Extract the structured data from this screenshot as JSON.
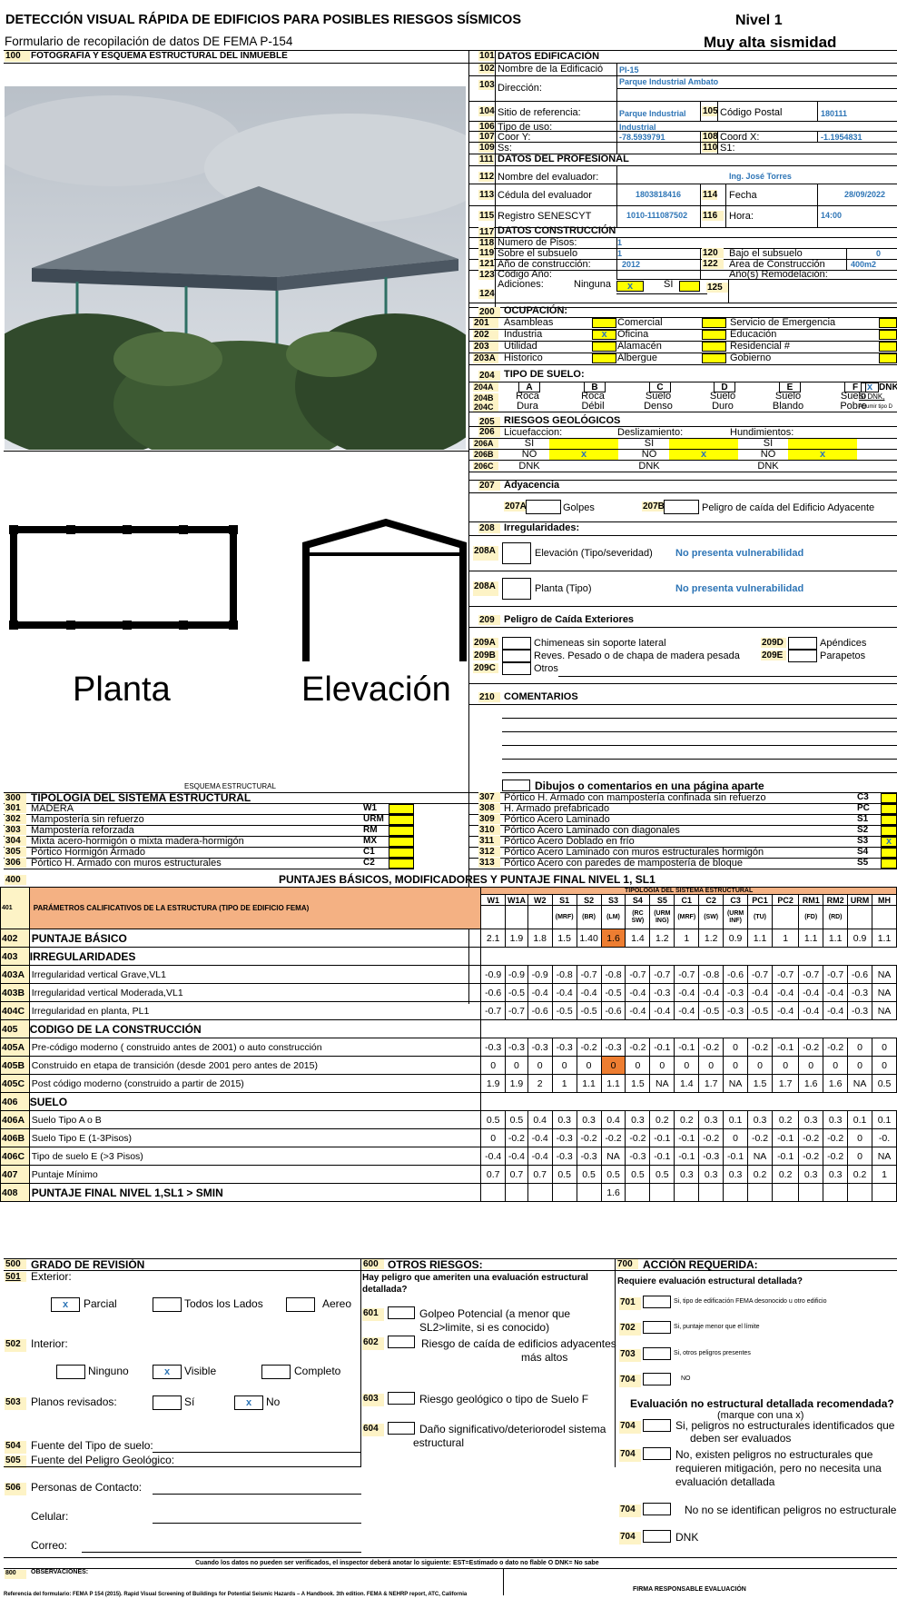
{
  "header": {
    "title": "DETECCIÓN VISUAL RÁPIDA DE EDIFICIOS PARA POSIBLES RIESGOS SÍSMICOS",
    "subtitle": "Formulario de recopilación de datos DE FEMA P-154",
    "level": "Nivel 1",
    "seismicity": "Muy alta sismidad"
  },
  "photo_section": {
    "num": "100",
    "label": "FOTOGRAFÍA Y ESQUEMA ESTRUCTURAL DEL INMUEBLE",
    "plan_label": "Planta",
    "elev_label": "Elevación",
    "schema_label": "ESQUEMA ESTRUCTURAL"
  },
  "building": {
    "r101": {
      "n": "101",
      "l": "DATOS EDIFICACIÓN"
    },
    "r102": {
      "n": "102",
      "l": "Nombre de la Edificació",
      "v": "PI-15"
    },
    "r103": {
      "n": "103",
      "l": "Dirección:",
      "v": "Parque Industrial Ambato"
    },
    "r104": {
      "n": "104",
      "l": "Sitio de referencia:",
      "v": "Parque Industrial"
    },
    "r105": {
      "n": "105",
      "l": "Código Postal",
      "v": "180111"
    },
    "r106": {
      "n": "106",
      "l": "Tipo de uso:",
      "v": "Industrial"
    },
    "r107": {
      "n": "107",
      "l": "Coor Y:",
      "v": "-78.5939791"
    },
    "r108": {
      "n": "108",
      "l": "Coord X:",
      "v": "-1.1954831"
    },
    "r109": {
      "n": "109",
      "l": "Ss:"
    },
    "r110": {
      "n": "110",
      "l": "S1:"
    }
  },
  "professional": {
    "r111": {
      "n": "111",
      "l": "DATOS DEL PROFESIONAL"
    },
    "r112": {
      "n": "112",
      "l": "Nombre del evaluador:",
      "v": "Ing. José Torres"
    },
    "r113": {
      "n": "113",
      "l": "Cédula del evaluador",
      "v": "1803818416"
    },
    "r114": {
      "n": "114",
      "l": "Fecha",
      "v": "28/09/2022"
    },
    "r115": {
      "n": "115",
      "l": "Registro SENESCYT",
      "v": "1010-111087502"
    },
    "r116": {
      "n": "116",
      "l": "Hora:",
      "v": "14:00"
    }
  },
  "construction": {
    "r117": {
      "n": "117",
      "l": "DATOS CONSTRUCCIÓN"
    },
    "r118": {
      "n": "118",
      "l": "Numero de Pisos:",
      "v": "1"
    },
    "r119": {
      "n": "119",
      "l": "Sobre el subsuelo",
      "v": "1"
    },
    "r120": {
      "n": "120",
      "l": "Bajo el subsuelo",
      "v": "0"
    },
    "r121": {
      "n": "121",
      "l": "Año de construcción:",
      "v": "2012"
    },
    "r122": {
      "n": "122",
      "l": "Area de Construcción",
      "v": "400m2"
    },
    "r123": {
      "n": "123",
      "l": "Código Año:"
    },
    "r123b": {
      "l": "Año(s) Remodelación:"
    },
    "r124": {
      "n": "124",
      "l": "Adiciones:",
      "none": "Ninguna",
      "si": "SI",
      "mark": "x"
    },
    "r125": {
      "n": "125"
    }
  },
  "occupancy": {
    "n": "200",
    "title": "OCUPACIÓN:",
    "rows": [
      {
        "n": "201",
        "a": "Asambleas",
        "b": "Comercial",
        "c": "Servicio de  Emergencia"
      },
      {
        "n": "202",
        "a": "Industria",
        "am": "x",
        "b": "Oficina",
        "c": "Educación"
      },
      {
        "n": "203",
        "a": "Utilidad",
        "b": "Alamacén",
        "c": "Residencial #"
      },
      {
        "n": "203A",
        "a": "Historico",
        "b": "Albergue",
        "c": "Gobierno"
      }
    ]
  },
  "soil": {
    "n": "204",
    "title": "TIPO DE SUELO:",
    "n_a": "204A",
    "n_b": "204B",
    "n_c": "204C",
    "letters": [
      "A",
      "B",
      "C",
      "D",
      "E",
      "F"
    ],
    "dnk_mark": "x",
    "dnk": "DNK",
    "row_b": [
      "Roca",
      "Roca",
      "Suelo",
      "Suelo",
      "Suelo",
      "Suelo"
    ],
    "row_c": [
      "Dura",
      "Débil",
      "Denso",
      "Duro",
      "Blando",
      "Pobre"
    ],
    "dnk_b": "Si DNK,",
    "dnk_c": "ASumir tipo D"
  },
  "geo": {
    "n": "205",
    "title": "RIESGOS GEOLÓGICOS",
    "n206": "206",
    "liq": "Licuefaccion:",
    "des": "Deslizamiento:",
    "hun": "Hundimientos:",
    "n206a": "206A",
    "n206b": "206B",
    "n206c": "206C",
    "si": "SI",
    "no": "NO",
    "dnk": "DNK",
    "mark": "x"
  },
  "adjacency": {
    "n": "207",
    "title": "Adyacencia",
    "n207a": "207A",
    "golpes": "Golpes",
    "n207b": "207B",
    "peligro": "Peligro de caída del Edificio Adyacente"
  },
  "irregular": {
    "n": "208",
    "title": "Irregularidades:",
    "n208a": "208A",
    "elev": "Elevación (Tipo/severidad)",
    "elev_v": "No presenta vulnerabilidad",
    "plan": "Planta (Tipo)",
    "plan_v": "No presenta vulnerabilidad"
  },
  "exterior": {
    "n": "209",
    "title": "Peligro de Caída Exteriores",
    "n209a": "209A",
    "n209b": "209B",
    "n209c": "209C",
    "n209d": "209D",
    "n209e": "209E",
    "a": "Chimeneas sin soporte lateral",
    "b": "Reves. Pesado o de chapa de madera pesada",
    "c": "Otros",
    "d": "Apéndices",
    "e": "Parapetos"
  },
  "comments": {
    "n": "210",
    "title": "COMENTARIOS",
    "note": "Dibujos o comentarios en una página aparte"
  },
  "typology": {
    "n": "300",
    "title": "TIPOLOGIA DEL SISTEMA ESTRUCTURAL",
    "left": [
      {
        "n": "301",
        "l": "MADERA",
        "c": "W1"
      },
      {
        "n": "302",
        "l": "Mampostería sin refuerzo",
        "c": "URM"
      },
      {
        "n": "303",
        "l": "Mampostería reforzada",
        "c": "RM"
      },
      {
        "n": "304",
        "l": "Mixta acero-hormigón o mixta madera-hormigón",
        "c": "MX"
      },
      {
        "n": "305",
        "l": "Pórtico Hormigón Armado",
        "c": "C1"
      },
      {
        "n": "306",
        "l": "Pórtico H. Armado con muros estructurales",
        "c": "C2"
      }
    ],
    "right": [
      {
        "n": "307",
        "l": "Pórtico H. Armado con mampostería confinada sin refuerzo",
        "c": "C3"
      },
      {
        "n": "308",
        "l": "H. Armado prefabricado",
        "c": "PC"
      },
      {
        "n": "309",
        "l": "Pórtico Acero Laminado",
        "c": "S1"
      },
      {
        "n": "310",
        "l": "Pórtico Acero Laminado con diagonales",
        "c": "S2"
      },
      {
        "n": "311",
        "l": "Pórtico Acero Doblado en frío",
        "c": "S3",
        "m": "x"
      },
      {
        "n": "312",
        "l": "Pórtico Acero Laminado con muros estructurales hormigón",
        "c": "S4"
      },
      {
        "n": "313",
        "l": "Pórtico Acero con paredes de mampostería de bloque",
        "c": "S5"
      }
    ]
  },
  "scores": {
    "n400": "400",
    "title": "PUNTAJES BÁSICOS, MODIFICADORES Y PUNTAJE FINAL NIVEL 1,  SL1",
    "n401": "401",
    "param": "PARÁMETROS CALIFICATIVOS DE LA ESTRUCTURA (TIPO DE EDIFICIO FEMA)",
    "typ_header": "TIPOLOGIA DEL SISTEMA ESTRUCTURAL",
    "cols": [
      "W1",
      "W1A",
      "W2",
      "S1",
      "S2",
      "S3",
      "S4",
      "S5",
      "C1",
      "C2",
      "C3",
      "PC1",
      "PC2",
      "RM1",
      "RM2",
      "URM",
      "MH"
    ],
    "subs": [
      "",
      "",
      "",
      "(MRF)",
      "(BR)",
      "(LM)",
      "(RC SW)",
      "(URM ING)",
      "(MRF)",
      "(SW)",
      "(URM INF)",
      "(TU)",
      "",
      "(FD)",
      "(RD)",
      "",
      ""
    ],
    "rows": [
      {
        "n": "402",
        "l": "PUNTAJE BÁSICO",
        "b": true,
        "v": [
          "2.1",
          "1.9",
          "1.8",
          "1.5",
          "1.40",
          "1.6",
          "1.4",
          "1.2",
          "1",
          "1.2",
          "0.9",
          "1.1",
          "1",
          "1.1",
          "1.1",
          "0.9",
          "1.1"
        ]
      },
      {
        "n": "403",
        "l": "IRREGULARIDADES",
        "sec": true
      },
      {
        "n": "403A",
        "l": "Irregularidad vertical Grave,VL1",
        "v": [
          "-0.9",
          "-0.9",
          "-0.9",
          "-0.8",
          "-0.7",
          "-0.8",
          "-0.7",
          "-0.7",
          "-0.7",
          "-0.8",
          "-0.6",
          "-0.7",
          "-0.7",
          "-0.7",
          "-0.7",
          "-0.6",
          "NA"
        ]
      },
      {
        "n": "403B",
        "l": "Irregularidad vertical Moderada,VL1",
        "v": [
          "-0.6",
          "-0.5",
          "-0.4",
          "-0.4",
          "-0.4",
          "-0.5",
          "-0.4",
          "-0.3",
          "-0.4",
          "-0.4",
          "-0.3",
          "-0.4",
          "-0.4",
          "-0.4",
          "-0.4",
          "-0.3",
          "NA"
        ]
      },
      {
        "n": "404C",
        "l": "Irregularidad en planta, PL1",
        "v": [
          "-0.7",
          "-0.7",
          "-0.6",
          "-0.5",
          "-0.5",
          "-0.6",
          "-0.4",
          "-0.4",
          "-0.4",
          "-0.5",
          "-0.3",
          "-0.5",
          "-0.4",
          "-0.4",
          "-0.4",
          "-0.3",
          "NA"
        ]
      },
      {
        "n": "405",
        "l": "CODIGO DE LA CONSTRUCCIÓN",
        "sec": true
      },
      {
        "n": "405A",
        "l": "Pre-código moderno ( construido antes de 2001) o auto construcción",
        "v": [
          "-0.3",
          "-0.3",
          "-0.3",
          "-0.3",
          "-0.2",
          "-0.3",
          "-0.2",
          "-0.1",
          "-0.1",
          "-0.2",
          "0",
          "-0.2",
          "-0.1",
          "-0.2",
          "-0.2",
          "0",
          "0"
        ]
      },
      {
        "n": "405B",
        "l": "Construido en etapa de transición (desde 2001 pero antes de 2015)",
        "v": [
          "0",
          "0",
          "0",
          "0",
          "0",
          "0",
          "0",
          "0",
          "0",
          "0",
          "0",
          "0",
          "0",
          "0",
          "0",
          "0",
          "0"
        ],
        "hlrow": true
      },
      {
        "n": "405C",
        "l": "Post código moderno (construido a partir de 2015)",
        "v": [
          "1.9",
          "1.9",
          "2",
          "1",
          "1.1",
          "1.1",
          "1.5",
          "NA",
          "1.4",
          "1.7",
          "NA",
          "1.5",
          "1.7",
          "1.6",
          "1.6",
          "NA",
          "0.5"
        ]
      },
      {
        "n": "406",
        "l": "SUELO",
        "sec": true
      },
      {
        "n": "406A",
        "l": "Suelo Tipo A o B",
        "v": [
          "0.5",
          "0.5",
          "0.4",
          "0.3",
          "0.3",
          "0.4",
          "0.3",
          "0.2",
          "0.2",
          "0.3",
          "0.1",
          "0.3",
          "0.2",
          "0.3",
          "0.3",
          "0.1",
          "0.1"
        ]
      },
      {
        "n": "406B",
        "l": "Suelo Tipo E (1-3Pisos)",
        "v": [
          "0",
          "-0.2",
          "-0.4",
          "-0.3",
          "-0.2",
          "-0.2",
          "-0.2",
          "-0.1",
          "-0.1",
          "-0.2",
          "0",
          "-0.2",
          "-0.1",
          "-0.2",
          "-0.2",
          "0",
          "-0."
        ]
      },
      {
        "n": "406C",
        "l": "Tipo de suelo E (>3 Pisos)",
        "v": [
          "-0.4",
          "-0.4",
          "-0.4",
          "-0.3",
          "-0.3",
          "NA",
          "-0.3",
          "-0.1",
          "-0.1",
          "-0.3",
          "-0.1",
          "NA",
          "-0.1",
          "-0.2",
          "-0.2",
          "0",
          "NA"
        ]
      },
      {
        "n": "407",
        "l": "Puntaje Mínimo",
        "v": [
          "0.7",
          "0.7",
          "0.7",
          "0.5",
          "0.5",
          "0.5",
          "0.5",
          "0.5",
          "0.3",
          "0.3",
          "0.3",
          "0.2",
          "0.2",
          "0.3",
          "0.3",
          "0.2",
          "1"
        ]
      },
      {
        "n": "408",
        "l": "PUNTAJE FINAL NIVEL 1,SL1 > SMIN",
        "b": true,
        "v": [
          "",
          "",
          "",
          "",
          "",
          "1.6",
          "",
          "",
          "",
          "",
          "",
          "",
          "",
          "",
          "",
          "",
          ""
        ]
      }
    ]
  },
  "review": {
    "n500": "500",
    "title": "GRADO DE REVISIÓN",
    "n501": "501",
    "ext": "Exterior:",
    "parcial": "Parcial",
    "todos": "Todos los Lados",
    "aereo": "Aereo",
    "x": "x",
    "n502": "502",
    "int": "Interior:",
    "ninguno": "Ninguno",
    "visible": "Visible",
    "completo": "Completo",
    "n503": "503",
    "planos": "Planos revisados:",
    "si": "Sí",
    "no": "No",
    "n504": "504",
    "suelo": "Fuente del Tipo de suelo:",
    "n505": "505",
    "geo": "Fuente del Peligro Geológico:",
    "n506": "506",
    "contacto": "Personas de Contacto:",
    "celular": "Celular:",
    "correo": "Correo:"
  },
  "other": {
    "n600": "600",
    "title": "OTROS RIESGOS:",
    "q": "Hay peligro que ameriten una evaluación estructural detallada?",
    "n601": "601",
    "r601a": "Golpeo Potencial (a menor que",
    "r601b": "SL2>limite, si es conocido)",
    "n602": "602",
    "r602a": "Riesgo de caída de edificios adyacentes",
    "r602b": "más altos",
    "n603": "603",
    "r603": "Riesgo geológico o tipo de Suelo F",
    "n604": "604",
    "r604a": "Daño significativo/deteriorodel sistema",
    "r604b": "estructural"
  },
  "action": {
    "n700": "700",
    "title": "ACCIÓN REQUERIDA:",
    "q": "Requiere evaluación estructural detallada?",
    "n701": "701",
    "r701": "Si, tipo de edificación FEMA desonocido u otro edificio",
    "n702": "702",
    "r702": "Si, puntaje menor que el límite",
    "n703": "703",
    "r703": "Si, otros peligros presentes",
    "n704": "704",
    "r704": "NO",
    "rec": "Evaluación no estructural detallada recomendada?",
    "rec2": "(marque con una x)",
    "a1": "Si, peligros no estructurales identificados que",
    "a1b": "deben ser evaluados",
    "a2": "No, existen peligros no estructurales que",
    "a2b": "requieren mitigación, pero no necesita una",
    "a2c": "evaluación detallada",
    "a3": "No no se identifican peligros no estructurales",
    "a4": "DNK"
  },
  "footer": {
    "note": "Cuando los datos no pueden ser verificados, el inspector deberá anotar lo siguiente: EST=Estimado o dato no flable O DNK= No sabe",
    "n800": "800",
    "obs": "OBSERVACIONES:",
    "firma": "FIRMA  RESPONSABLE EVALUACIÓN",
    "ref": "Referencia del formulario: FEMA P 154 (2015). Rapid Visual Screening of Buildings for Potential Seismic Hazards – A Handbook. 3th edition. FEMA & NEHRP report, ATC, California"
  }
}
